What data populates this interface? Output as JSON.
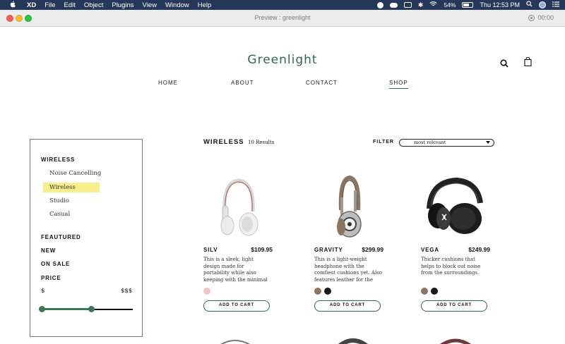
{
  "menubar": {
    "app": "XD",
    "items": [
      "File",
      "Edit",
      "Object",
      "Plugins",
      "View",
      "Window",
      "Help"
    ],
    "battery": "54%",
    "clock": "Thu 12:53 PM"
  },
  "window": {
    "title": "Preview : greenlight",
    "timer": "00:00"
  },
  "site": {
    "logo": "Greenlight",
    "nav": [
      "HOME",
      "ABOUT",
      "CONTACT",
      "SHOP"
    ],
    "active_nav": "SHOP"
  },
  "sidebar": {
    "category": "WIRELESS",
    "subcategories": [
      "Noise Cancelling",
      "Wireless",
      "Studio",
      "Casual"
    ],
    "selected_subcategory": "Wireless",
    "sections": [
      "FEAUTURED",
      "NEW",
      "ON SALE",
      "PRICE"
    ],
    "price_min_label": "$",
    "price_max_label": "$$$",
    "price_range": {
      "low": 0,
      "high": 0.55
    }
  },
  "results": {
    "title": "WIRELESS",
    "count": "10 Results",
    "filter_label": "FILTER",
    "filter_value": "most relevant"
  },
  "products": [
    {
      "name": "SILV",
      "price": "$109.95",
      "description": "This is a sleek, light design made for portability while also keeping with the minimal design trend.",
      "swatches": [
        "#f3c6c3"
      ],
      "button": "ADD TO CART"
    },
    {
      "name": "GRAVITY",
      "price": "$299.99",
      "description": "This is a light-weight headphone with the comfiest cushions yet. Also features leather for the",
      "swatches": [
        "#8c7560",
        "#1a1a1a"
      ],
      "button": "ADD TO CART"
    },
    {
      "name": "VEGA",
      "price": "$249.99",
      "description": "Thicker cushions that helps to block out noise from the surroundings.",
      "swatches": [
        "#8c7560",
        "#1a1a1a"
      ],
      "button": "ADD TO CART"
    }
  ],
  "colors": {
    "brand_green": "#2f6a4a",
    "highlight": "#f6ef8c",
    "menubar": "#26385a"
  }
}
